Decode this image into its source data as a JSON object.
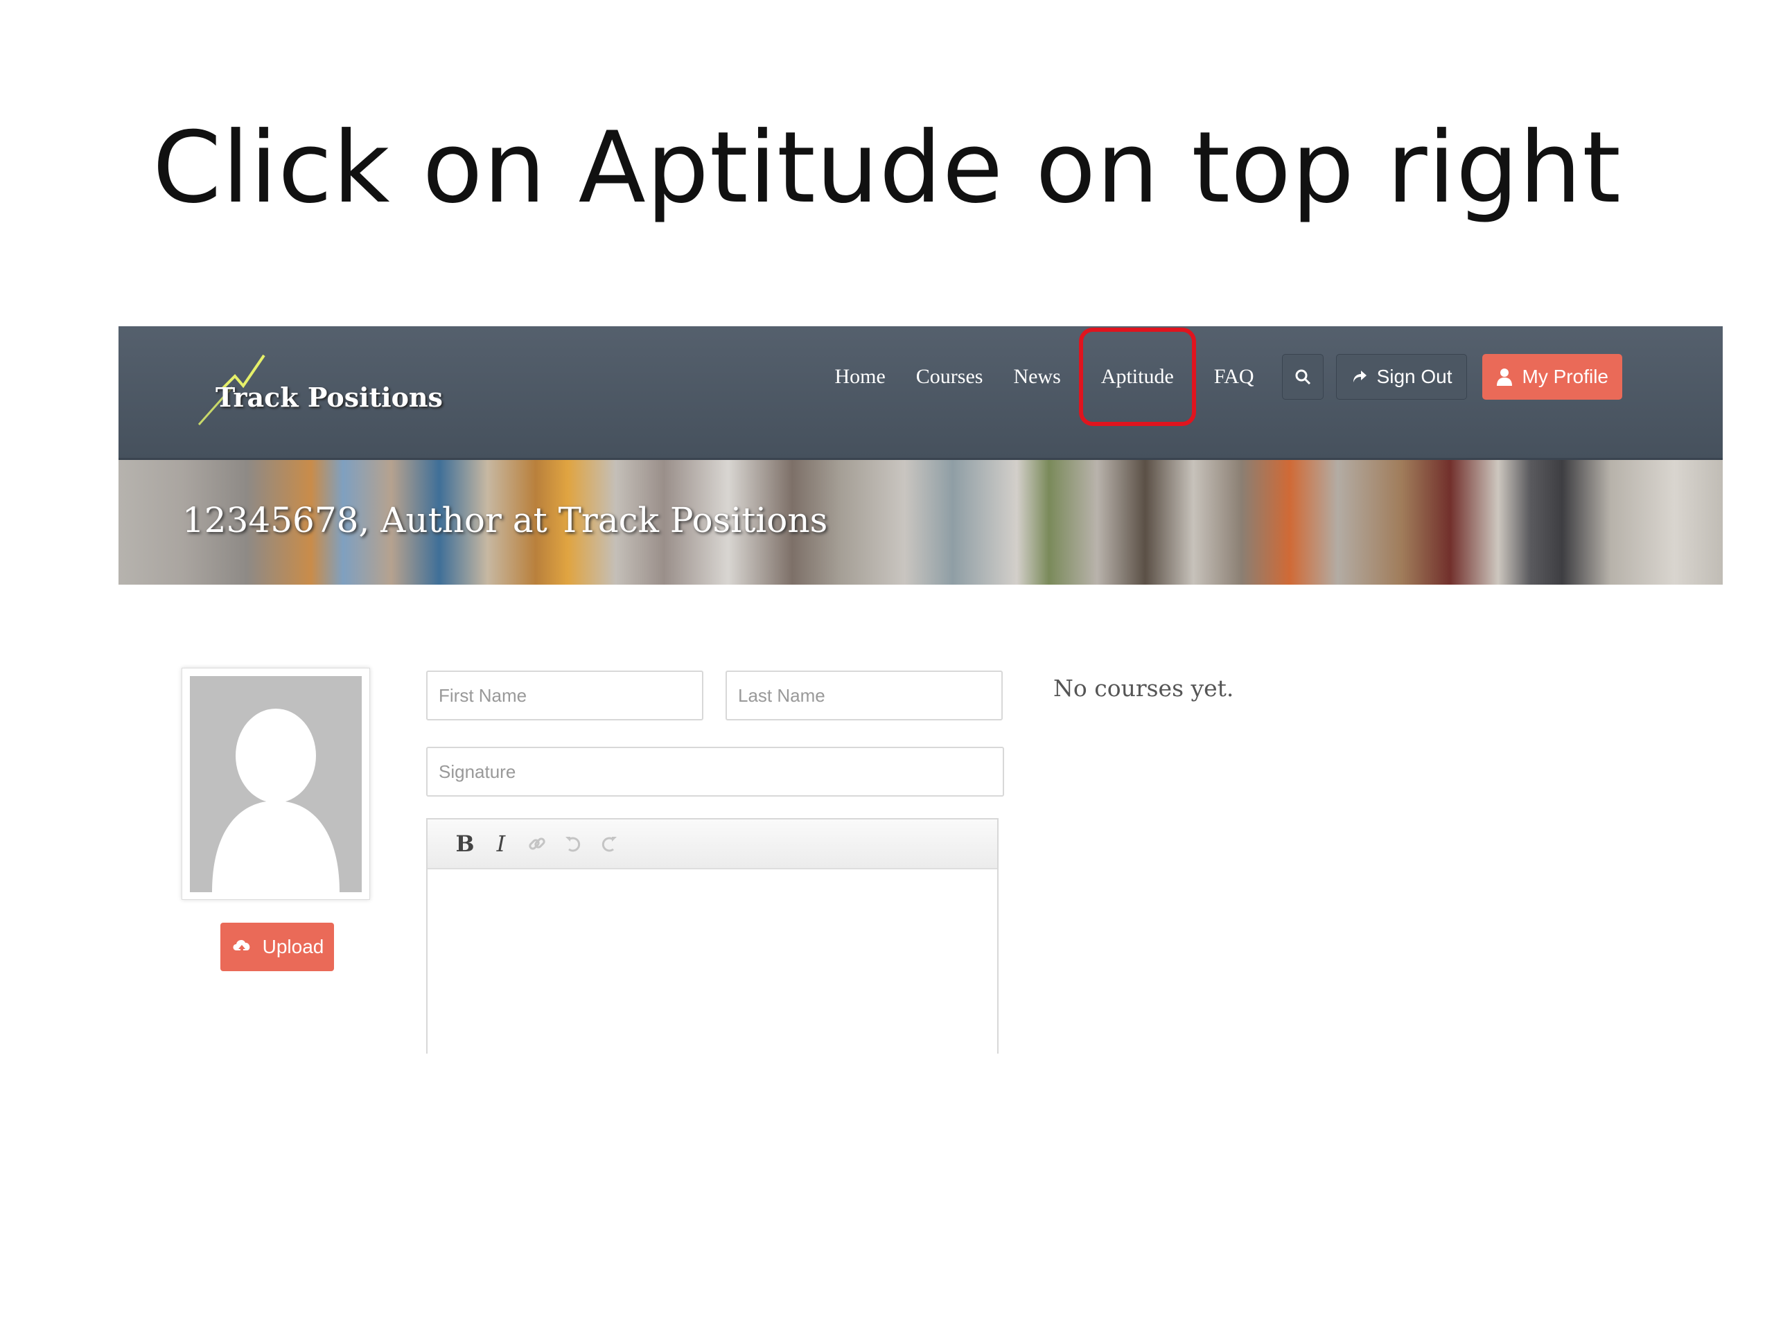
{
  "slide": {
    "title": "Click on Aptitude on top right"
  },
  "header": {
    "logo_text": "Track Positions",
    "nav": {
      "home": "Home",
      "courses": "Courses",
      "news": "News",
      "aptitude": "Aptitude",
      "faq": "FAQ"
    },
    "sign_out_label": "Sign Out",
    "my_profile_label": "My Profile"
  },
  "banner": {
    "title": "12345678, Author at Track Positions"
  },
  "profile": {
    "upload_label": "Upload",
    "first_name_placeholder": "First Name",
    "last_name_placeholder": "Last Name",
    "signature_placeholder": "Signature",
    "editor_toolbar": {
      "bold": "B",
      "italic": "I"
    }
  },
  "courses": {
    "empty_text": "No courses yet."
  },
  "colors": {
    "navbar": "#4e5966",
    "accent": "#ea6a58",
    "highlight": "#e0141e"
  }
}
